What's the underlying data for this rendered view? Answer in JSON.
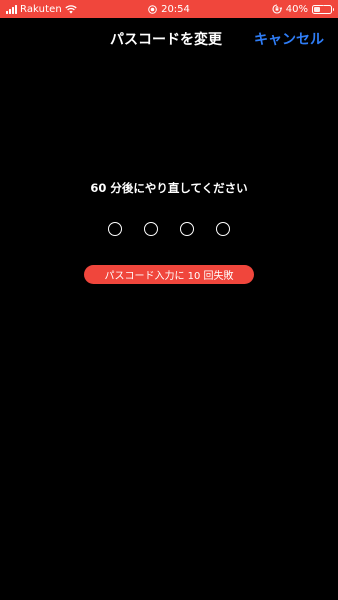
{
  "status_bar": {
    "carrier": "Rakuten",
    "time": "20:54",
    "battery_percent": "40%",
    "battery_level": 0.4,
    "background_color": "#f0463c",
    "icons": [
      "signal-icon",
      "wifi-icon",
      "screen-recording-icon",
      "orientation-lock-icon",
      "battery-icon",
      "charging-bolt-icon"
    ]
  },
  "nav": {
    "title": "パスコードを変更",
    "cancel_label": "キャンセル",
    "cancel_color": "#2f7df6"
  },
  "lockout": {
    "message": "60 分後にやり直してください",
    "passcode_length": 4,
    "filled_dots": 0,
    "failed_attempts_label": "パスコード入力に 10 回失敗",
    "badge_color": "#f0463c"
  }
}
